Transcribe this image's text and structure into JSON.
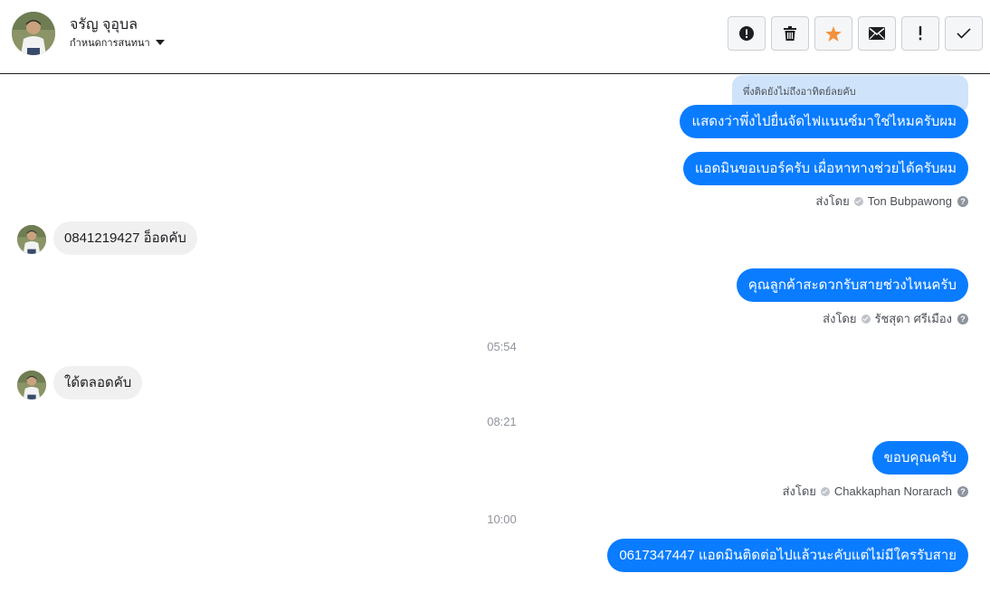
{
  "header": {
    "contact_name": "จรัญ จุอุบล",
    "assign_label": "กำหนดการสนทนา"
  },
  "toolbar": {
    "buttons": [
      {
        "icon": "exclamation-circle-icon",
        "label": "mark-spam"
      },
      {
        "icon": "trash-icon",
        "label": "delete"
      },
      {
        "icon": "star-icon",
        "label": "star",
        "color": "#f5923e"
      },
      {
        "icon": "envelope-icon",
        "label": "mark-unread"
      },
      {
        "icon": "exclamation-icon",
        "label": "follow-up"
      },
      {
        "icon": "checkmark-icon",
        "label": "done"
      }
    ]
  },
  "messages": {
    "reply_preview": "พึ่งติดยังไม่ถึงอาทิตย์ลยคับ",
    "m1": "แสดงว่าพึ่งไปยื่นจัดไฟแนนซ์มาใช่ไหมครับผม",
    "m2": "แอดมินขอเบอร์ครับ เผื่อหาทางช่วยได้ครับผม",
    "sent_by_1_prefix": "ส่งโดย",
    "sent_by_1_name": "Ton Bubpawong",
    "m3": "0841219427  อ็อดคับ",
    "m4": "คุณลูกค้าสะดวกรับสายช่วงไหนครับ",
    "sent_by_2_prefix": "ส่งโดย",
    "sent_by_2_name": "รัชสุดา ศรีเมือง",
    "time_1": "05:54",
    "m5": "ใด้ตลอดคับ",
    "time_2": "08:21",
    "m6": "ขอบคุณครับ",
    "sent_by_3_prefix": "ส่งโดย",
    "sent_by_3_name": "Chakkaphan Norarach",
    "time_3": "10:00",
    "m7": "0617347447 แอดมินติดต่อไปแล้วนะคับแต่ไม่มีใครรับสาย"
  },
  "colors": {
    "outgoing_bubble": "#0a7cff",
    "incoming_bubble": "#f1f0f0",
    "reply_preview_bg": "#cfe3fb"
  }
}
